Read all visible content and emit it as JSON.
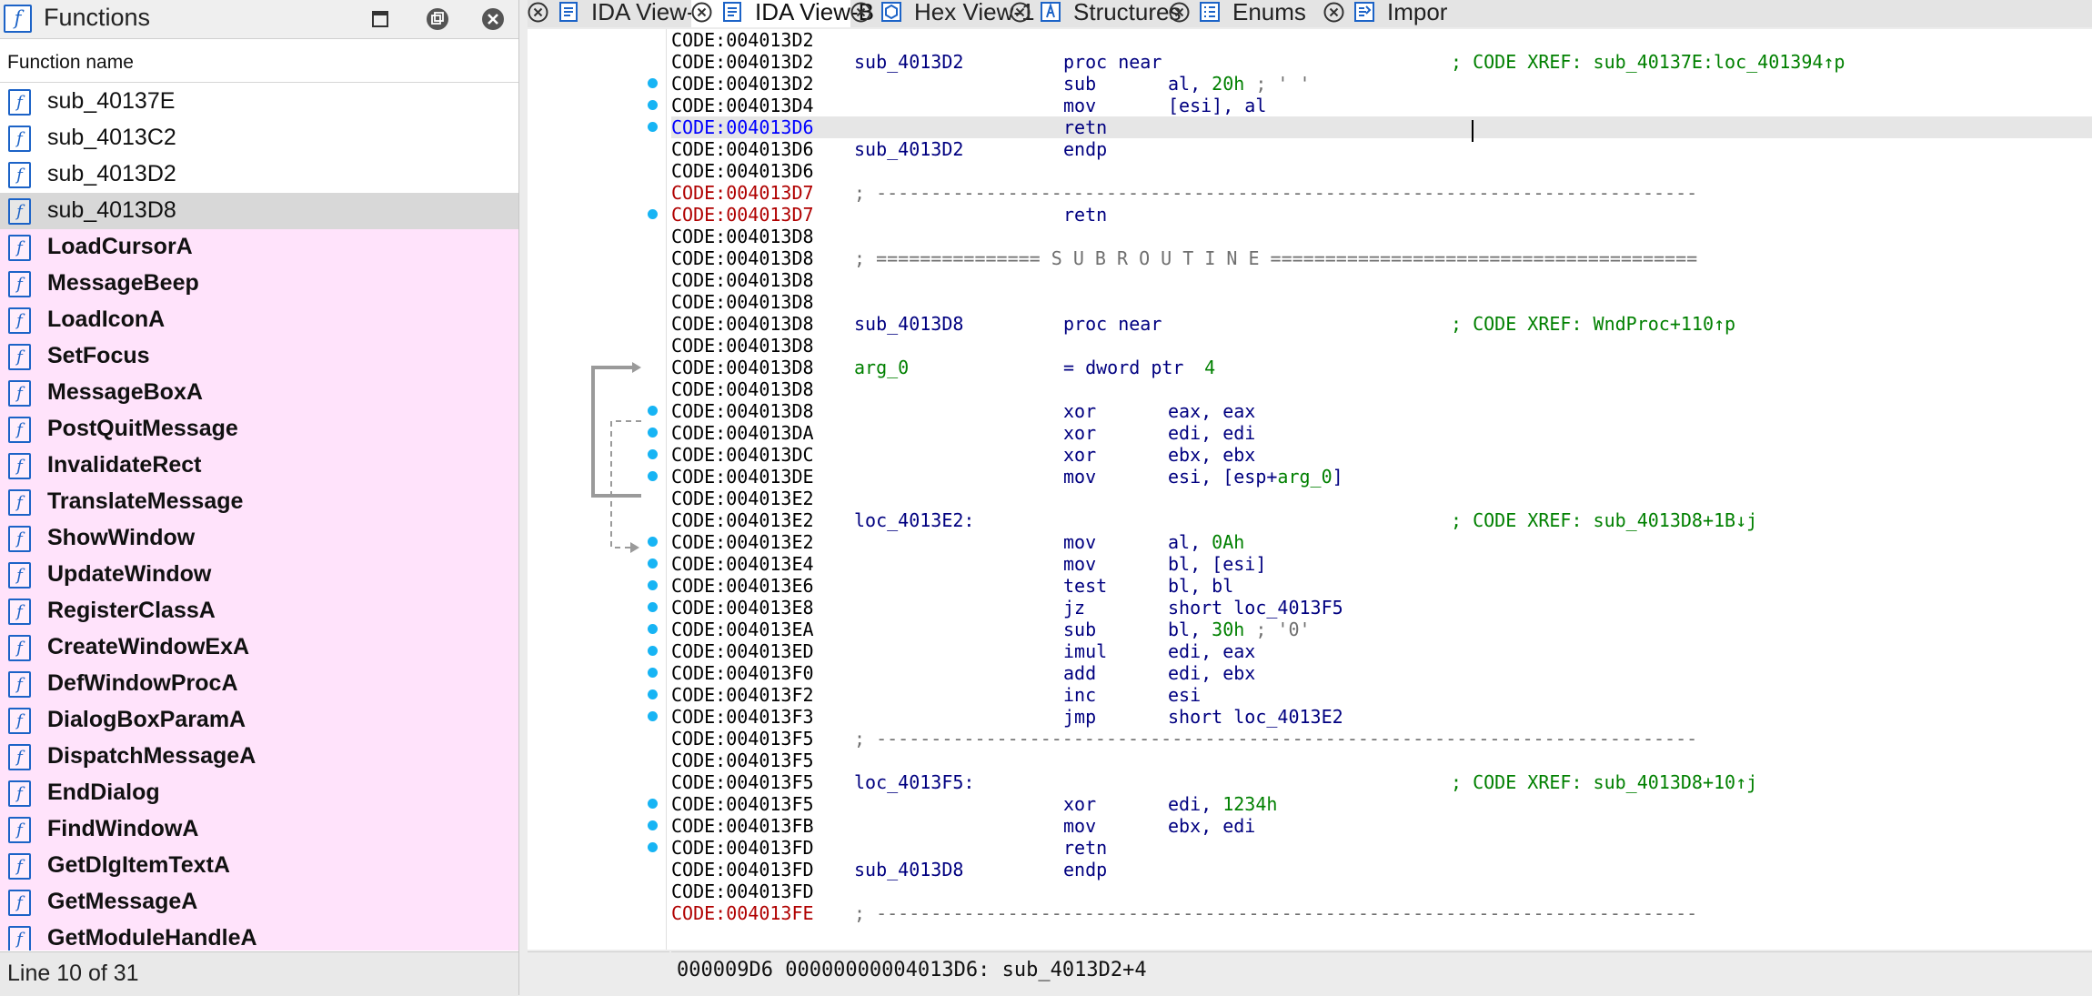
{
  "functions_panel": {
    "title": "Functions",
    "column_header": "Function name",
    "status": "Line 10 of 31",
    "items": [
      {
        "name": "sub_40137E",
        "imported": false
      },
      {
        "name": "sub_4013C2",
        "imported": false
      },
      {
        "name": "sub_4013D2",
        "imported": false
      },
      {
        "name": "sub_4013D8",
        "imported": false,
        "selected": true
      },
      {
        "name": "LoadCursorA",
        "imported": true
      },
      {
        "name": "MessageBeep",
        "imported": true
      },
      {
        "name": "LoadIconA",
        "imported": true
      },
      {
        "name": "SetFocus",
        "imported": true
      },
      {
        "name": "MessageBoxA",
        "imported": true
      },
      {
        "name": "PostQuitMessage",
        "imported": true
      },
      {
        "name": "InvalidateRect",
        "imported": true
      },
      {
        "name": "TranslateMessage",
        "imported": true
      },
      {
        "name": "ShowWindow",
        "imported": true
      },
      {
        "name": "UpdateWindow",
        "imported": true
      },
      {
        "name": "RegisterClassA",
        "imported": true
      },
      {
        "name": "CreateWindowExA",
        "imported": true
      },
      {
        "name": "DefWindowProcA",
        "imported": true
      },
      {
        "name": "DialogBoxParamA",
        "imported": true
      },
      {
        "name": "DispatchMessageA",
        "imported": true
      },
      {
        "name": "EndDialog",
        "imported": true
      },
      {
        "name": "FindWindowA",
        "imported": true
      },
      {
        "name": "GetDlgItemTextA",
        "imported": true
      },
      {
        "name": "GetMessageA",
        "imported": true
      },
      {
        "name": "GetModuleHandleA",
        "imported": true
      }
    ]
  },
  "tabs": [
    {
      "label": "IDA View-A",
      "icon": "ida-view-icon",
      "active": false
    },
    {
      "label": "IDA View-B",
      "icon": "ida-view-icon",
      "active": true
    },
    {
      "label": "Hex View-1",
      "icon": "hex-view-icon",
      "active": false
    },
    {
      "label": "Structures",
      "icon": "structures-icon",
      "active": false
    },
    {
      "label": "Enums",
      "icon": "enums-icon",
      "active": false
    },
    {
      "label": "Impor",
      "icon": "imports-icon",
      "active": false
    }
  ],
  "disassembly": {
    "lines": [
      {
        "addr": "CODE:004013D2"
      },
      {
        "addr": "CODE:004013D2",
        "label": "sub_4013D2",
        "mnem": "proc near",
        "comment": "; CODE XREF: sub_40137E:loc_401394↑p"
      },
      {
        "addr": "CODE:004013D2",
        "mnem": "sub",
        "op": "al, ",
        "op_hi": "20h",
        "op_tail": " ; ' '",
        "dot": true
      },
      {
        "addr": "CODE:004013D4",
        "mnem": "mov",
        "op": "[esi], al",
        "dot": true
      },
      {
        "addr": "CODE:004013D6",
        "mnem": "retn",
        "dot": true,
        "addr_color": "blue",
        "highlight": true
      },
      {
        "addr": "CODE:004013D6",
        "label": "sub_4013D2",
        "mnem": "endp"
      },
      {
        "addr": "CODE:004013D6"
      },
      {
        "addr": "CODE:004013D7",
        "sep": "; ---------------------------------------------------------------------------",
        "addr_color": "red"
      },
      {
        "addr": "CODE:004013D7",
        "mnem": "retn",
        "dot": true,
        "addr_color": "red"
      },
      {
        "addr": "CODE:004013D8"
      },
      {
        "addr": "CODE:004013D8",
        "sep": "; =============== S U B R O U T I N E ======================================="
      },
      {
        "addr": "CODE:004013D8"
      },
      {
        "addr": "CODE:004013D8"
      },
      {
        "addr": "CODE:004013D8",
        "label": "sub_4013D8",
        "mnem": "proc near",
        "comment": "; CODE XREF: WndProc+110↑p"
      },
      {
        "addr": "CODE:004013D8"
      },
      {
        "addr": "CODE:004013D8",
        "label": "arg_0",
        "label_green": true,
        "mnem": "= dword ptr",
        "op_hi": "  4"
      },
      {
        "addr": "CODE:004013D8"
      },
      {
        "addr": "CODE:004013D8",
        "mnem": "xor",
        "op": "eax, eax",
        "dot": true
      },
      {
        "addr": "CODE:004013DA",
        "mnem": "xor",
        "op": "edi, edi",
        "dot": true
      },
      {
        "addr": "CODE:004013DC",
        "mnem": "xor",
        "op": "ebx, ebx",
        "dot": true
      },
      {
        "addr": "CODE:004013DE",
        "mnem": "mov",
        "op": "esi, [esp+",
        "op_hi": "arg_0",
        "op_tail": "]",
        "dot": true
      },
      {
        "addr": "CODE:004013E2"
      },
      {
        "addr": "CODE:004013E2",
        "label": "loc_4013E2:",
        "comment": "; CODE XREF: sub_4013D8+1B↓j"
      },
      {
        "addr": "CODE:004013E2",
        "mnem": "mov",
        "op": "al, ",
        "op_hi": "0Ah",
        "dot": true
      },
      {
        "addr": "CODE:004013E4",
        "mnem": "mov",
        "op": "bl, [esi]",
        "dot": true
      },
      {
        "addr": "CODE:004013E6",
        "mnem": "test",
        "op": "bl, bl",
        "dot": true
      },
      {
        "addr": "CODE:004013E8",
        "mnem": "jz",
        "op": "short loc_4013F5",
        "dot": true
      },
      {
        "addr": "CODE:004013EA",
        "mnem": "sub",
        "op": "bl, ",
        "op_hi": "30h",
        "op_tail": " ; '0'",
        "dot": true
      },
      {
        "addr": "CODE:004013ED",
        "mnem": "imul",
        "op": "edi, eax",
        "dot": true
      },
      {
        "addr": "CODE:004013F0",
        "mnem": "add",
        "op": "edi, ebx",
        "dot": true
      },
      {
        "addr": "CODE:004013F2",
        "mnem": "inc",
        "op": "esi",
        "dot": true
      },
      {
        "addr": "CODE:004013F3",
        "mnem": "jmp",
        "op": "short loc_4013E2",
        "dot": true
      },
      {
        "addr": "CODE:004013F5",
        "sep": "; ---------------------------------------------------------------------------"
      },
      {
        "addr": "CODE:004013F5"
      },
      {
        "addr": "CODE:004013F5",
        "label": "loc_4013F5:",
        "comment": "; CODE XREF: sub_4013D8+10↑j"
      },
      {
        "addr": "CODE:004013F5",
        "mnem": "xor",
        "op": "edi, ",
        "op_hi": "1234h",
        "dot": true
      },
      {
        "addr": "CODE:004013FB",
        "mnem": "mov",
        "op": "ebx, edi",
        "dot": true
      },
      {
        "addr": "CODE:004013FD",
        "mnem": "retn",
        "dot": true
      },
      {
        "addr": "CODE:004013FD",
        "label": "sub_4013D8",
        "mnem": "endp"
      },
      {
        "addr": "CODE:004013FD"
      },
      {
        "addr": "CODE:004013FE",
        "sep": "; ---------------------------------------------------------------------------",
        "addr_color": "red"
      }
    ],
    "status": "000009D6 00000000004013D6: sub_4013D2+4"
  },
  "colors": {
    "import_bg": "#ffe3fb",
    "selected_bg": "#d8d8d8",
    "breakpoint_dot": "#17b4f4",
    "code_blue": "#000080",
    "comment_green": "#008000"
  }
}
